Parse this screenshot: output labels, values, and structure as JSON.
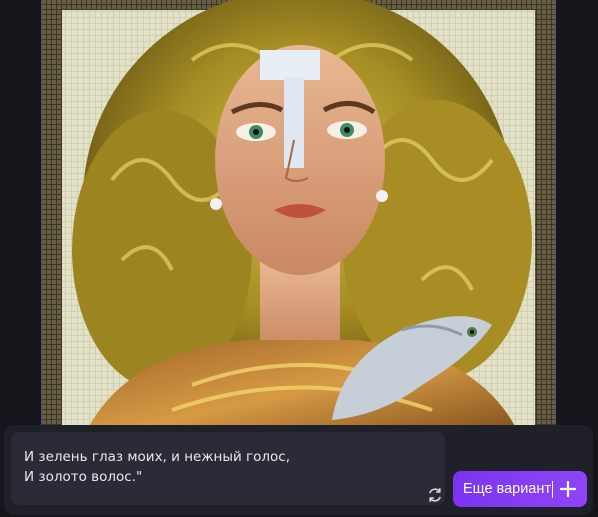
{
  "image": {
    "icon": "mosaic-portrait-image"
  },
  "prompt": {
    "text": "И зелень глаз моих, и нежный голос,\nИ золото волос.\""
  },
  "actions": {
    "refresh_icon": "refresh-icon",
    "more_label": "Еще вариант",
    "more_icon": "plus-icon"
  },
  "colors": {
    "background": "#15161c",
    "panel": "#1f2029",
    "input": "#2a2b36",
    "accent": "#8a3ff4"
  }
}
